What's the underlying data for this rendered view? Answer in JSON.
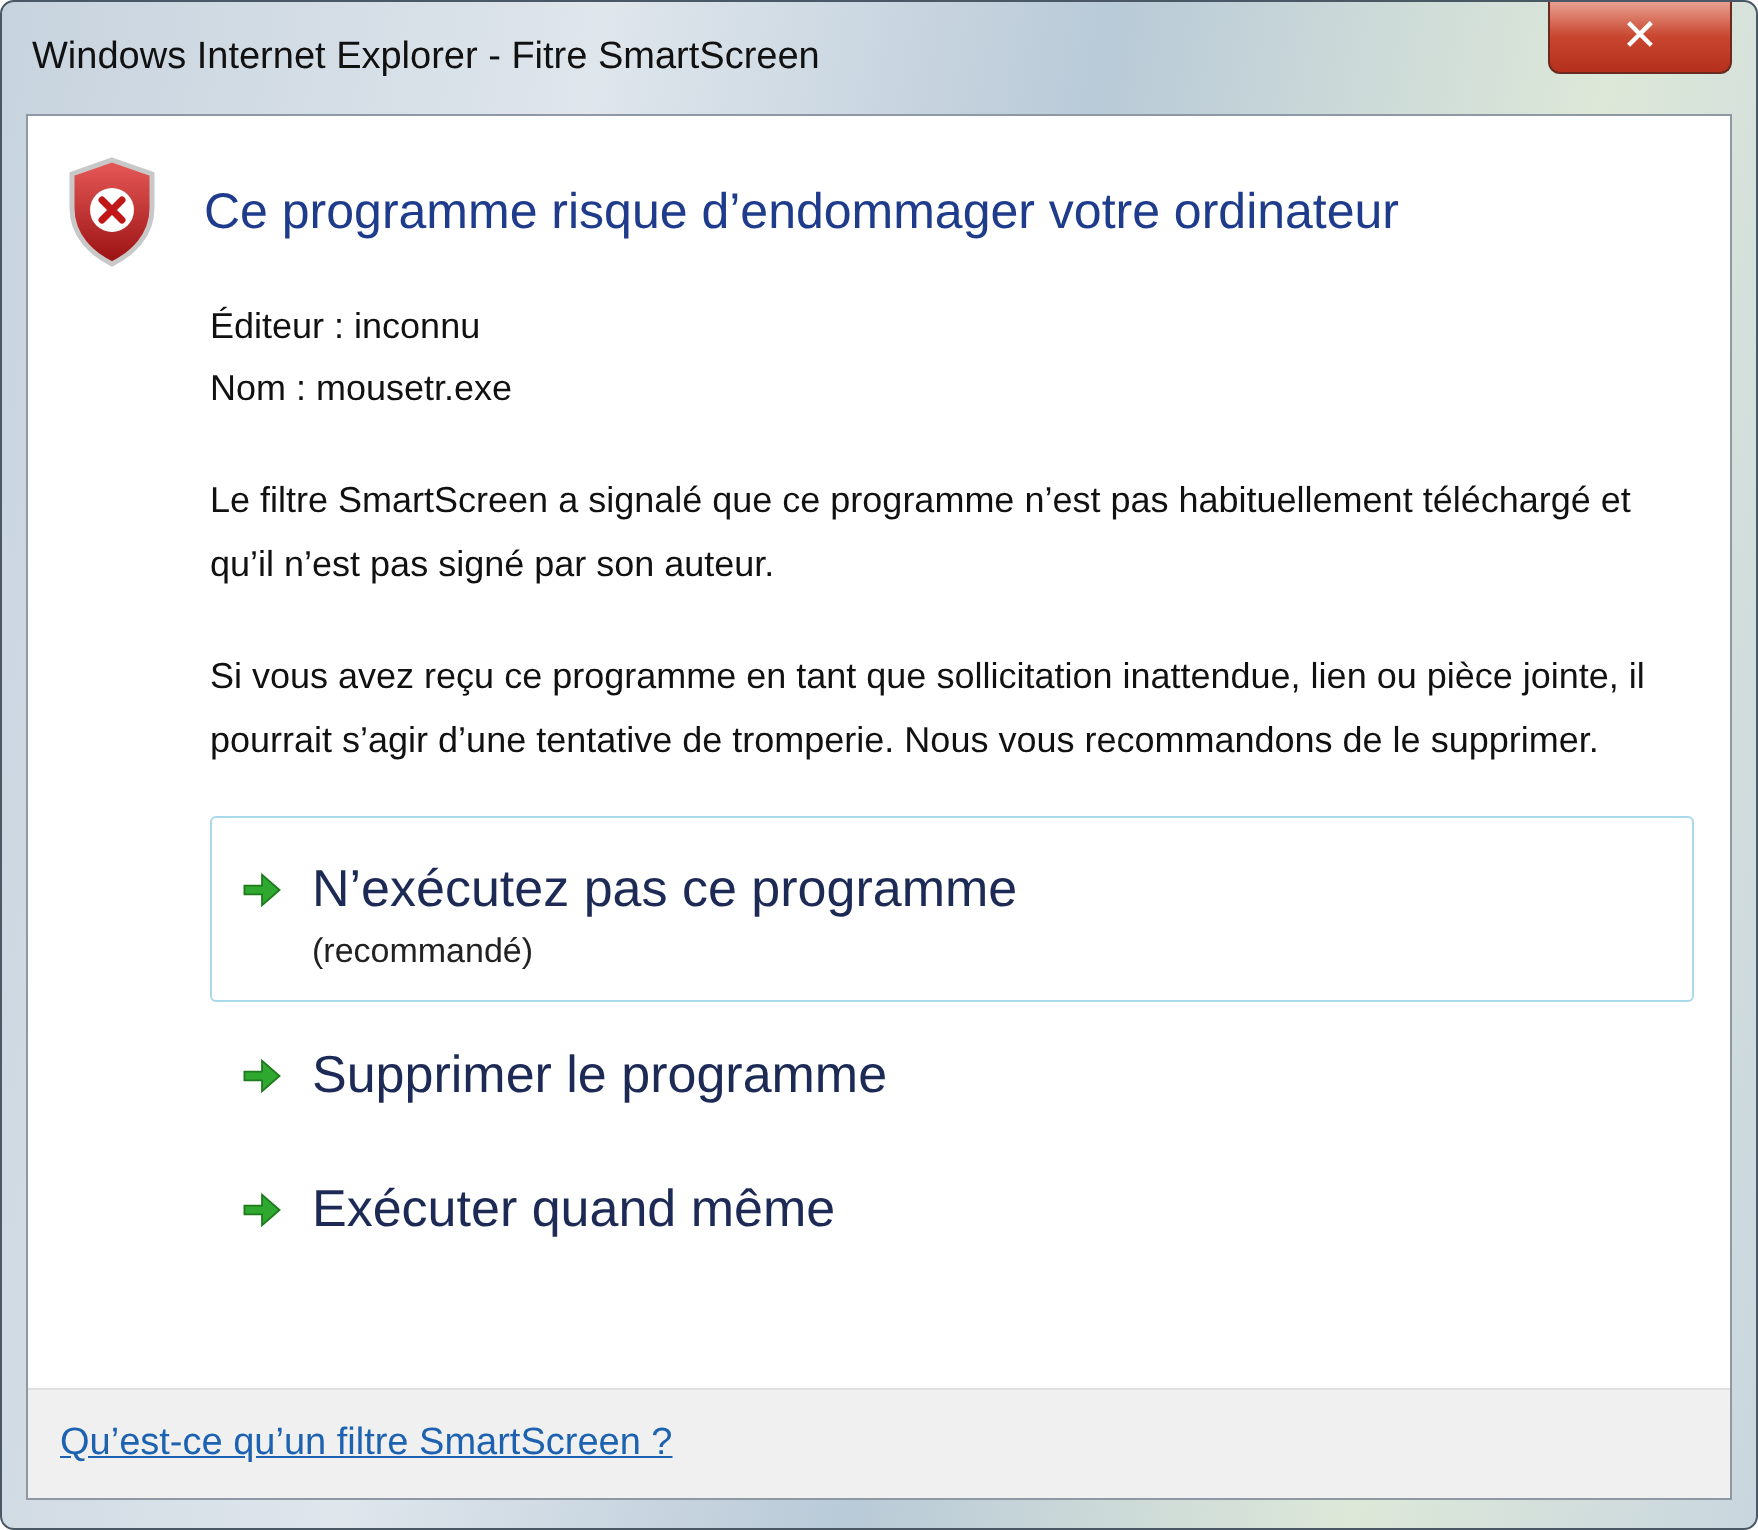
{
  "window": {
    "title": "Windows Internet Explorer - Fitre SmartScreen",
    "close": "✕"
  },
  "heading": "Ce programme risque d’endommager votre ordinateur",
  "details": [
    "Éditeur : inconnu",
    "Nom : mousetr.exe"
  ],
  "paragraphs": [
    "Le filtre SmartScreen a signalé que ce programme n’est pas habituellement téléchargé et qu’il n’est pas signé par son auteur.",
    "Si vous avez reçu ce programme en tant que sollicitation inattendue, lien ou pièce jointe, il pourrait s’agir d’une tentative de tromperie. Nous vous recommandons de le supprimer."
  ],
  "options": [
    {
      "label": "N’exécutez pas ce programme",
      "note": "(recommandé)",
      "selected": true
    },
    {
      "label": "Supprimer le programme",
      "selected": false
    },
    {
      "label": "Exécuter quand même",
      "selected": false
    }
  ],
  "footer_link": "Qu’est-ce qu’un filtre SmartScreen ?"
}
